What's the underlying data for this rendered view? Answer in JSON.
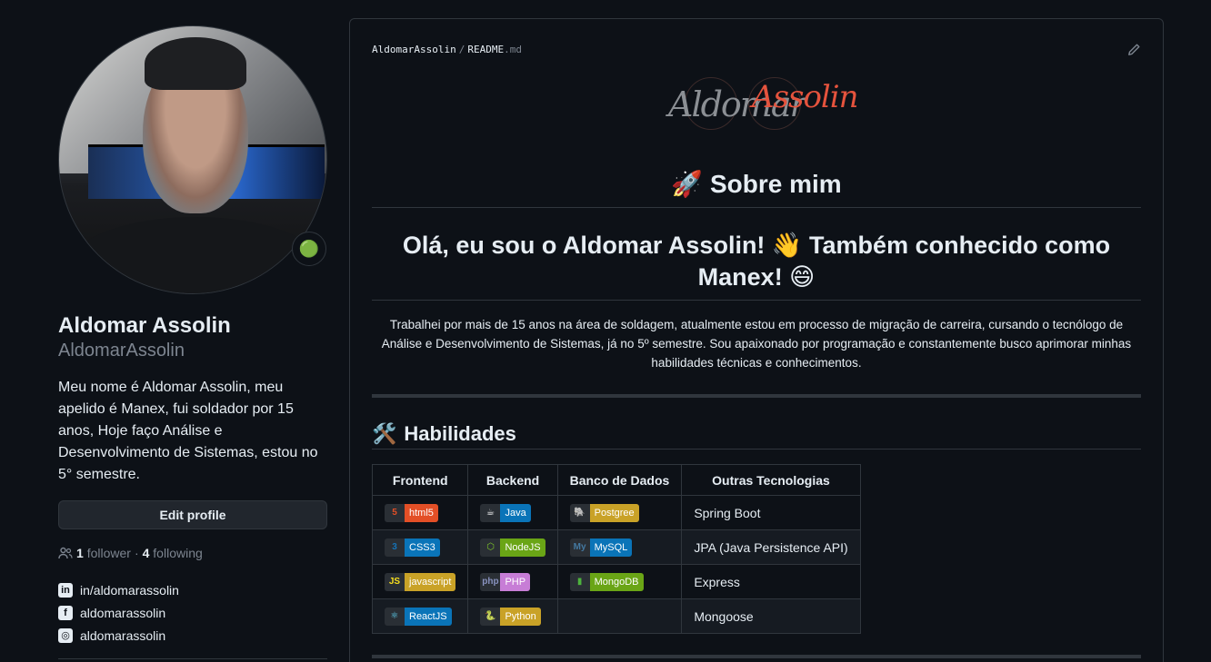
{
  "profile": {
    "name": "Aldomar Assolin",
    "login": "AldomarAssolin",
    "bio": "Meu nome é Aldomar Assolin, meu apelido é Manex, fui soldador por 15 anos, Hoje faço Análise e Desenvolvimento de Sistemas, estou no 5° semestre.",
    "edit_label": "Edit profile",
    "followers_count": "1",
    "followers_label": "follower",
    "following_count": "4",
    "following_label": "following",
    "social": [
      {
        "icon": "linkedin-icon",
        "glyph": "in",
        "text": "in/aldomarassolin"
      },
      {
        "icon": "facebook-icon",
        "glyph": "f",
        "text": "aldomarassolin"
      },
      {
        "icon": "instagram-icon",
        "glyph": "◎",
        "text": "aldomarassolin"
      }
    ]
  },
  "readme": {
    "crumb_user": "AldomarAssolin",
    "crumb_sep": "/",
    "crumb_file": "README",
    "crumb_ext": ".md",
    "logo_left": "Aldomar",
    "logo_right": "Assolin",
    "heading_sobre": "🚀 Sobre mim",
    "heading_ola": "Olá, eu sou o Aldomar Assolin! 👋 Também conhecido como Manex! 😄",
    "paragraph": "Trabalhei por mais de 15 anos na área de soldagem, atualmente estou em processo de migração de carreira, cursando o tecnólogo de Análise e Desenvolvimento de Sistemas, já no 5º semestre. Sou apaixonado por programação e constantemente busco aprimorar minhas habilidades técnicas e conhecimentos.",
    "heading_hab_icon": "🛠️",
    "heading_hab": "Habilidades",
    "table": {
      "headers": [
        "Frontend",
        "Backend",
        "Banco de Dados",
        "Outras Tecnologias"
      ],
      "rows": [
        {
          "frontend": {
            "label": "html5",
            "glyph": "5",
            "glyph_color": "#e34f26",
            "color": "#e34f26"
          },
          "backend": {
            "label": "Java",
            "glyph": "☕",
            "glyph_color": "#ffffff",
            "color": "#0a74b8"
          },
          "db": {
            "label": "Postgree",
            "glyph": "🐘",
            "glyph_color": "#9aa",
            "color": "#c9a227"
          },
          "other": "Spring Boot"
        },
        {
          "frontend": {
            "label": "CSS3",
            "glyph": "3",
            "glyph_color": "#1572b6",
            "color": "#0a74b8"
          },
          "backend": {
            "label": "NodeJS",
            "glyph": "⬡",
            "glyph_color": "#83cd29",
            "color": "#6aa516"
          },
          "db": {
            "label": "MySQL",
            "glyph": "My",
            "glyph_color": "#4479a1",
            "color": "#0a74b8"
          },
          "other": "JPA (Java Persistence API)"
        },
        {
          "frontend": {
            "label": "javascript",
            "glyph": "JS",
            "glyph_color": "#f7df1e",
            "color": "#c9a227"
          },
          "backend": {
            "label": "PHP",
            "glyph": "php",
            "glyph_color": "#8892bf",
            "color": "#c77dd6"
          },
          "db": {
            "label": "MongoDB",
            "glyph": "▮",
            "glyph_color": "#4db33d",
            "color": "#6aa516"
          },
          "other": "Express"
        },
        {
          "frontend": {
            "label": "ReactJS",
            "glyph": "⚛",
            "glyph_color": "#61dafb",
            "color": "#0a74b8"
          },
          "backend": {
            "label": "Python",
            "glyph": "🐍",
            "glyph_color": "#3776ab",
            "color": "#c9a227"
          },
          "db": null,
          "other": "Mongoose"
        }
      ]
    }
  }
}
